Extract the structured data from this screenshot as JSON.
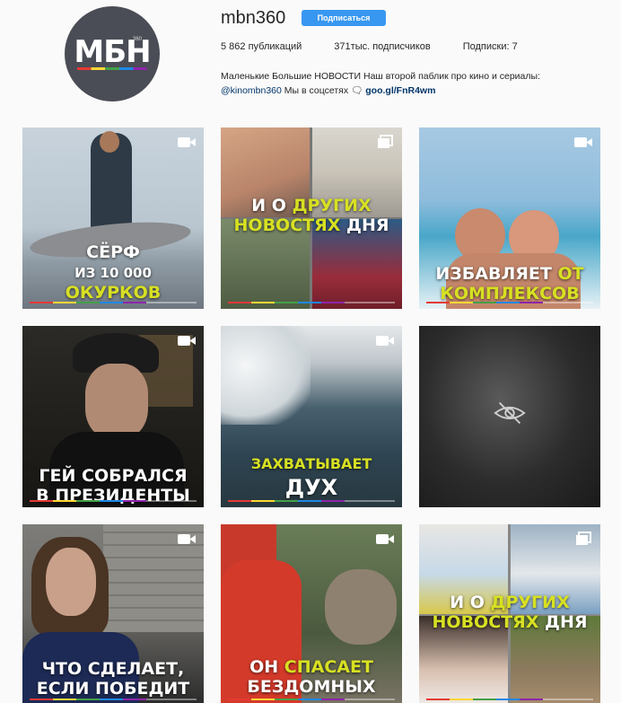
{
  "profile": {
    "avatar_logo": "МБН",
    "avatar_small": "360",
    "username": "mbn360",
    "follow_label": "Подписаться",
    "stats": {
      "posts": "5 862 публикаций",
      "followers": "371тыс. подписчиков",
      "following": "Подписки: 7"
    },
    "bio_line1": "Маленькие Большие НОВОСТИ Наш второй паблик про кино и сериалы:",
    "bio_mention": "@kinombn360",
    "bio_text": " Мы в соцсетях 🗨 ",
    "bio_link": "goo.gl/FnR4wm"
  },
  "posts": [
    {
      "lines": [
        [
          "СЁРФ",
          ""
        ],
        [
          "ИЗ 10 000",
          ""
        ],
        [
          "",
          "ОКУРКОВ"
        ]
      ],
      "video": true
    },
    {
      "lines": [
        [
          "И О ",
          "ДРУГИХ"
        ],
        [
          "НОВОСТЯХ ",
          "ДНЯ"
        ]
      ],
      "video": false
    },
    {
      "lines": [
        [
          "ИЗБАВЛЯЕТ ",
          "ОТ"
        ],
        [
          "",
          "КОМПЛЕКСОВ"
        ]
      ],
      "video": true
    },
    {
      "lines": [
        [
          "ГЕЙ СОБРАЛСЯ",
          ""
        ],
        [
          "В ПРЕЗИДЕНТЫ",
          ""
        ]
      ],
      "video": true
    },
    {
      "lines": [
        [
          "",
          "ЗАХВАТЫВАЕТ"
        ],
        [
          "ДУХ",
          ""
        ]
      ],
      "video": true
    },
    {
      "lines": [],
      "video": false,
      "hidden": true
    },
    {
      "lines": [
        [
          "ЧТО СДЕЛАЕТ,",
          ""
        ],
        [
          "ЕСЛИ ПОБЕДИТ",
          ""
        ]
      ],
      "video": true
    },
    {
      "lines": [
        [
          "ОН ",
          "СПАСАЕТ"
        ],
        [
          "БЕЗДОМНЫХ",
          ""
        ]
      ],
      "video": true
    },
    {
      "lines": [
        [
          "И О ",
          "ДРУГИХ"
        ],
        [
          "НОВОСТЯХ ",
          "ДНЯ"
        ]
      ],
      "video": false
    }
  ]
}
